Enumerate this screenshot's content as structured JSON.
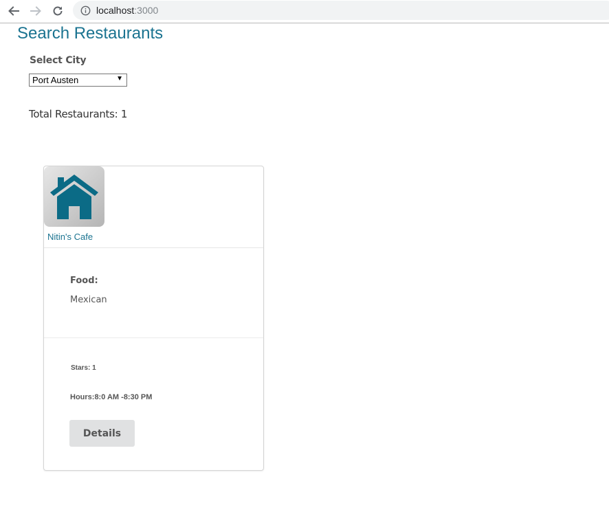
{
  "browser": {
    "url_host": "localhost",
    "url_port": ":3000"
  },
  "page": {
    "title": "Search Restaurants"
  },
  "filter": {
    "label": "Select City",
    "selected_city": "Port Austen"
  },
  "summary": {
    "total_text": "Total Restaurants: 1"
  },
  "restaurants": [
    {
      "name": "Nitin's Cafe",
      "food_label": "Food:",
      "food": "Mexican",
      "stars_text": "Stars: 1",
      "hours_text": "Hours:8:0 AM -8:30 PM",
      "details_label": "Details",
      "thumbnail_icon": "house-icon"
    }
  ],
  "colors": {
    "accent": "#1a7390",
    "button_bg": "#e0e1e2"
  }
}
